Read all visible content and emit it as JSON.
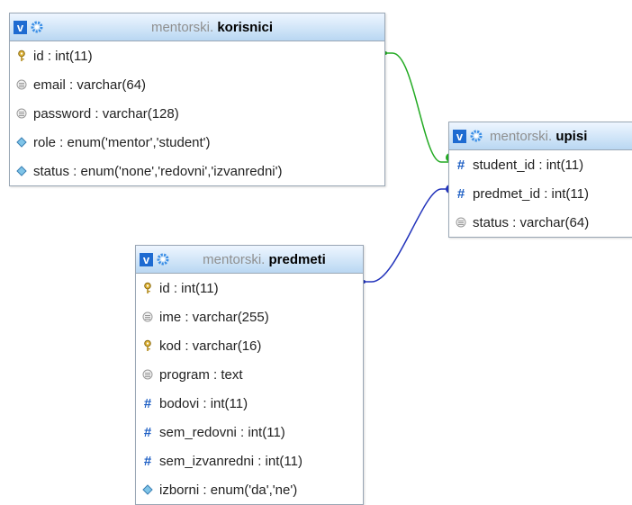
{
  "tables": {
    "korisnici": {
      "db": "mentorski.",
      "name": "korisnici",
      "toggle": "v",
      "columns": [
        {
          "text": "id : int(11)",
          "icon": "key-icon"
        },
        {
          "text": "email : varchar(64)",
          "icon": "field-icon"
        },
        {
          "text": "password : varchar(128)",
          "icon": "field-icon"
        },
        {
          "text": "role : enum('mentor','student')",
          "icon": "enum-icon"
        },
        {
          "text": "status : enum('none','redovni','izvanredni')",
          "icon": "enum-icon"
        }
      ]
    },
    "upisi": {
      "db": "mentorski.",
      "name": "upisi",
      "toggle": "v",
      "columns": [
        {
          "text": "student_id : int(11)",
          "icon": "hash-icon"
        },
        {
          "text": "predmet_id : int(11)",
          "icon": "hash-icon"
        },
        {
          "text": "status : varchar(64)",
          "icon": "field-icon"
        }
      ]
    },
    "predmeti": {
      "db": "mentorski.",
      "name": "predmeti",
      "toggle": "v",
      "columns": [
        {
          "text": "id : int(11)",
          "icon": "key-icon"
        },
        {
          "text": "ime : varchar(255)",
          "icon": "field-icon"
        },
        {
          "text": "kod : varchar(16)",
          "icon": "key-icon"
        },
        {
          "text": "program : text",
          "icon": "field-icon"
        },
        {
          "text": "bodovi : int(11)",
          "icon": "hash-icon"
        },
        {
          "text": "sem_redovni : int(11)",
          "icon": "hash-icon"
        },
        {
          "text": "sem_izvanredni : int(11)",
          "icon": "hash-icon"
        },
        {
          "text": "izborni : enum('da','ne')",
          "icon": "enum-icon"
        }
      ]
    }
  },
  "relations": [
    {
      "from": "korisnici.id",
      "to": "upisi.student_id",
      "color": "#22aa22"
    },
    {
      "from": "predmeti.id",
      "to": "upisi.predmet_id",
      "color": "#2233bb"
    }
  ]
}
